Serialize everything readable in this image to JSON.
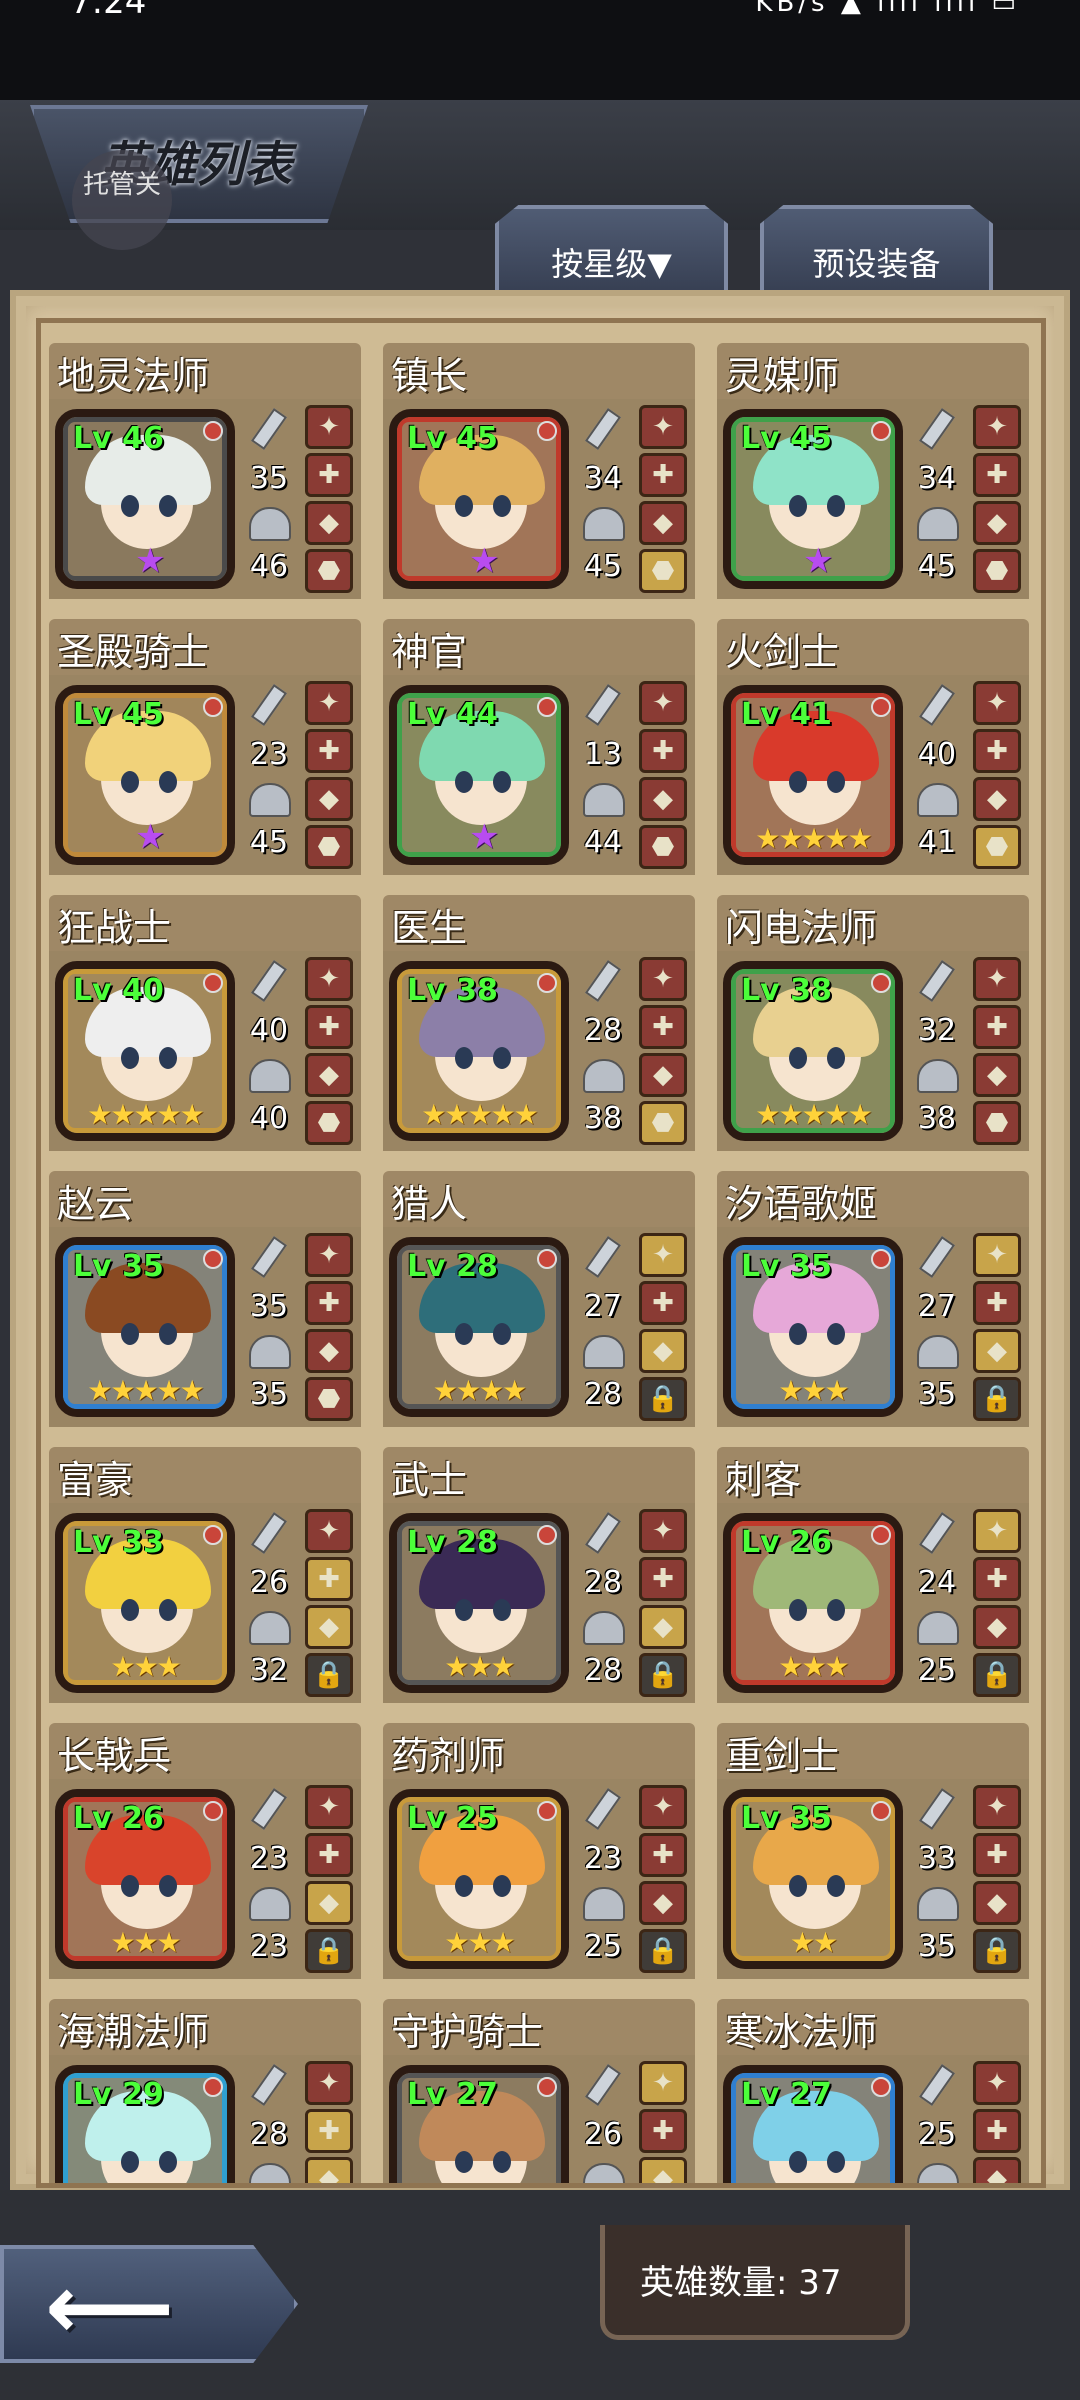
{
  "screen": {
    "title": "英雄列表",
    "trustee_label": "托管关",
    "sort_button": "按星级▼",
    "preset_button": "预设装备",
    "hero_count_label": "英雄数量: 37"
  },
  "heroes": [
    {
      "name": "地灵法师",
      "level": "Lv 46",
      "atk": "35",
      "def": "46",
      "stars": "★",
      "star_color": "purple",
      "frame": "#4a4a4a",
      "hair": "#e7ece8",
      "slots": [
        "r",
        "r",
        "r",
        "r"
      ]
    },
    {
      "name": "镇长",
      "level": "Lv 45",
      "atk": "34",
      "def": "45",
      "stars": "★",
      "star_color": "purple",
      "frame": "#c0392b",
      "hair": "#e0b060",
      "slots": [
        "r",
        "r",
        "r",
        "g"
      ]
    },
    {
      "name": "灵媒师",
      "level": "Lv 45",
      "atk": "34",
      "def": "45",
      "stars": "★",
      "star_color": "purple",
      "frame": "#3fa14a",
      "hair": "#8fe3c8",
      "slots": [
        "r",
        "r",
        "r",
        "r"
      ]
    },
    {
      "name": "圣殿骑士",
      "level": "Lv 45",
      "atk": "23",
      "def": "45",
      "stars": "★",
      "star_color": "purple",
      "frame": "#c08a3a",
      "hair": "#f1d27a",
      "slots": [
        "r",
        "r",
        "r",
        "r"
      ]
    },
    {
      "name": "神官",
      "level": "Lv 44",
      "atk": "13",
      "def": "44",
      "stars": "★",
      "star_color": "purple",
      "frame": "#3fa14a",
      "hair": "#7fd9b0",
      "slots": [
        "r",
        "r",
        "r",
        "r"
      ]
    },
    {
      "name": "火剑士",
      "level": "Lv 41",
      "atk": "40",
      "def": "41",
      "stars": "★★★★★",
      "star_color": "gold",
      "frame": "#c0392b",
      "hair": "#d93a2b",
      "slots": [
        "r",
        "r",
        "r",
        "g"
      ]
    },
    {
      "name": "狂战士",
      "level": "Lv 40",
      "atk": "40",
      "def": "40",
      "stars": "★★★★★",
      "star_color": "gold",
      "frame": "#c89a3a",
      "hair": "#eeeeee",
      "slots": [
        "r",
        "r",
        "r",
        "r"
      ]
    },
    {
      "name": "医生",
      "level": "Lv 38",
      "atk": "28",
      "def": "38",
      "stars": "★★★★★",
      "star_color": "gold",
      "frame": "#c89a3a",
      "hair": "#8c7fa8",
      "slots": [
        "r",
        "r",
        "r",
        "g"
      ]
    },
    {
      "name": "闪电法师",
      "level": "Lv 38",
      "atk": "32",
      "def": "38",
      "stars": "★★★★★",
      "star_color": "gold",
      "frame": "#3fa14a",
      "hair": "#e8d090",
      "slots": [
        "r",
        "r",
        "r",
        "r"
      ]
    },
    {
      "name": "赵云",
      "level": "Lv 35",
      "atk": "35",
      "def": "35",
      "stars": "★★★★★",
      "star_color": "gold",
      "frame": "#2f7fd0",
      "hair": "#8a4a22",
      "slots": [
        "r",
        "r",
        "r",
        "r"
      ]
    },
    {
      "name": "猎人",
      "level": "Lv 28",
      "atk": "27",
      "def": "28",
      "stars": "★★★★",
      "star_color": "gold",
      "frame": "#555555",
      "hair": "#2e6e7a",
      "slots": [
        "g",
        "r",
        "g",
        "lock"
      ]
    },
    {
      "name": "汐语歌姬",
      "level": "Lv 35",
      "atk": "27",
      "def": "35",
      "stars": "★★★",
      "star_color": "gold",
      "frame": "#2f7fd0",
      "hair": "#e6a8d8",
      "slots": [
        "g",
        "r",
        "g",
        "lock"
      ]
    },
    {
      "name": "富豪",
      "level": "Lv 33",
      "atk": "26",
      "def": "32",
      "stars": "★★★",
      "star_color": "gold",
      "frame": "#c89a3a",
      "hair": "#f2d040",
      "slots": [
        "r",
        "g",
        "g",
        "lock"
      ]
    },
    {
      "name": "武士",
      "level": "Lv 28",
      "atk": "28",
      "def": "28",
      "stars": "★★★",
      "star_color": "gold",
      "frame": "#555555",
      "hair": "#3a2a55",
      "slots": [
        "r",
        "r",
        "g",
        "lock"
      ]
    },
    {
      "name": "刺客",
      "level": "Lv 26",
      "atk": "24",
      "def": "25",
      "stars": "★★★",
      "star_color": "gold",
      "frame": "#c0392b",
      "hair": "#9fb878",
      "slots": [
        "g",
        "r",
        "r",
        "lock"
      ]
    },
    {
      "name": "长戟兵",
      "level": "Lv 26",
      "atk": "23",
      "def": "23",
      "stars": "★★★",
      "star_color": "gold",
      "frame": "#c0392b",
      "hair": "#d9442b",
      "slots": [
        "r",
        "r",
        "g",
        "lock"
      ]
    },
    {
      "name": "药剂师",
      "level": "Lv 25",
      "atk": "23",
      "def": "25",
      "stars": "★★★",
      "star_color": "gold",
      "frame": "#c89a3a",
      "hair": "#f0a040",
      "slots": [
        "r",
        "r",
        "r",
        "lock"
      ]
    },
    {
      "name": "重剑士",
      "level": "Lv 35",
      "atk": "33",
      "def": "35",
      "stars": "★★",
      "star_color": "gold",
      "frame": "#c89a3a",
      "hair": "#e8a84a",
      "slots": [
        "r",
        "r",
        "r",
        "lock"
      ]
    },
    {
      "name": "海潮法师",
      "level": "Lv 29",
      "atk": "28",
      "def": "",
      "stars": "",
      "star_color": "gold",
      "frame": "#2f9fd0",
      "hair": "#bff0ec",
      "slots": [
        "r",
        "g",
        "g",
        "lock"
      ]
    },
    {
      "name": "守护骑士",
      "level": "Lv 27",
      "atk": "26",
      "def": "",
      "stars": "",
      "star_color": "gold",
      "frame": "#555555",
      "hair": "#c0895a",
      "slots": [
        "g",
        "r",
        "g",
        "lock"
      ]
    },
    {
      "name": "寒冰法师",
      "level": "Lv 27",
      "atk": "25",
      "def": "",
      "stars": "",
      "star_color": "gold",
      "frame": "#2f7fd0",
      "hair": "#7fd0e8",
      "slots": [
        "r",
        "r",
        "r",
        "lock"
      ]
    }
  ]
}
